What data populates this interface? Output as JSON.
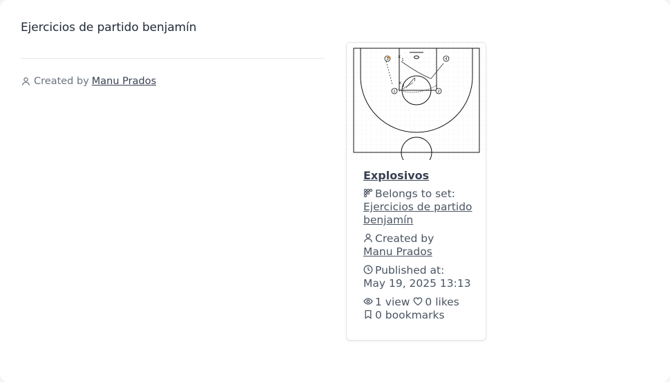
{
  "set": {
    "title": "Ejercicios de partido benjamín",
    "created_by_label": "Created by",
    "creator_name": "Manu Prados"
  },
  "card": {
    "drill_title": "Explosivos",
    "belongs_label": "Belongs to set:",
    "set_link": "Ejercicios de partido benjamín",
    "created_by_label": "Created by",
    "creator_name": "Manu Prados",
    "published_label": "Published at:",
    "published_date": "May 19, 2025 13:13",
    "views": "1 view",
    "likes": "0 likes",
    "bookmarks": "0 bookmarks",
    "court_markers": [
      "3",
      "4",
      "1",
      "2"
    ]
  },
  "colors": {
    "accent": "#374151",
    "muted": "#6b7280",
    "ball": "#e08a1e"
  }
}
